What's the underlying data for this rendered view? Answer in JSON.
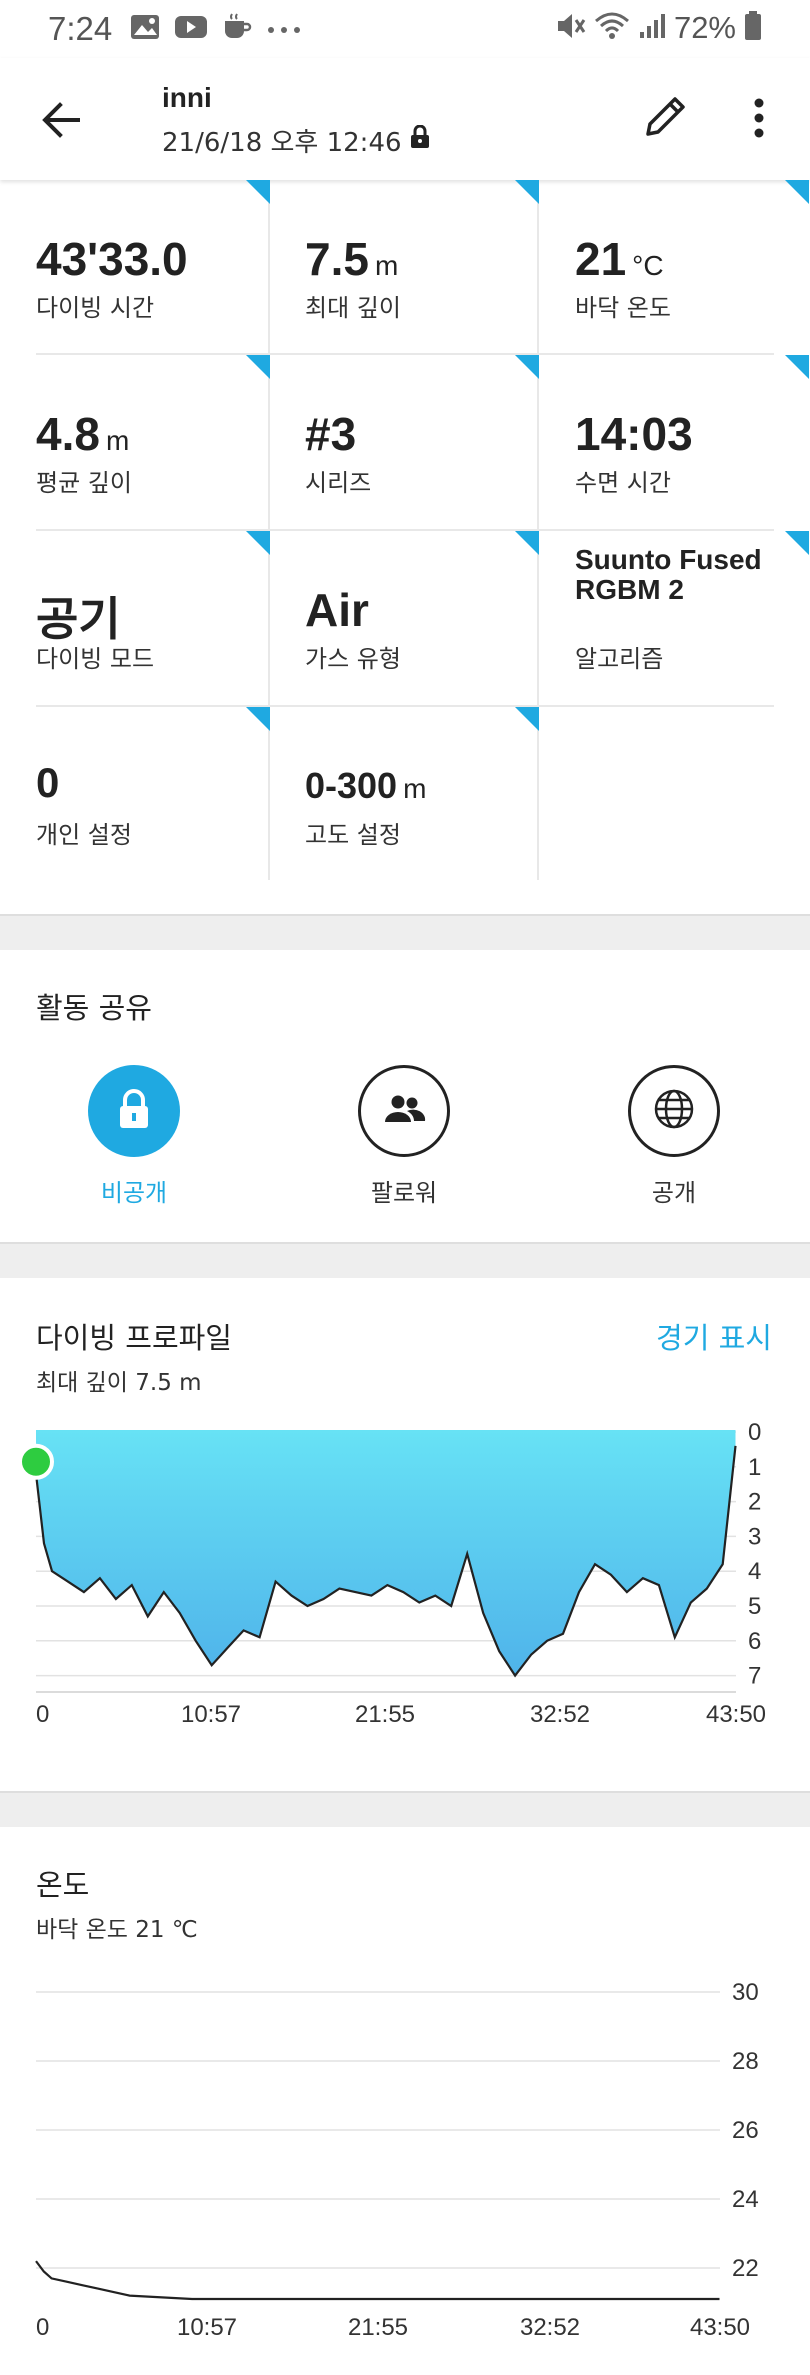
{
  "status_bar": {
    "time": "7:24",
    "battery": "72%"
  },
  "header": {
    "title": "inni",
    "subtitle": "21/6/18 오후 12:46",
    "icons": [
      "back-arrow-icon",
      "lock-icon",
      "edit-pencil-icon",
      "more-vert-icon"
    ]
  },
  "stats": [
    {
      "value": "43'33.0",
      "unit": "",
      "label": "다이빙 시간"
    },
    {
      "value": "7.5",
      "unit": "m",
      "label": "최대 깊이"
    },
    {
      "value": "21",
      "unit": "°C",
      "label": "바닥 온도"
    },
    {
      "value": "4.8",
      "unit": "m",
      "label": "평균 깊이"
    },
    {
      "value": "#3",
      "unit": "",
      "label": "시리즈"
    },
    {
      "value": "14:03",
      "unit": "",
      "label": "수면 시간"
    },
    {
      "value": "공기",
      "unit": "",
      "label": "다이빙 모드"
    },
    {
      "value": "Air",
      "unit": "",
      "label": "가스 유형"
    },
    {
      "value": "Suunto Fused RGBM 2",
      "unit": "",
      "label": "알고리즘"
    },
    {
      "value": "0",
      "unit": "",
      "label": "개인 설정"
    },
    {
      "value": "0-300",
      "unit": "m",
      "label": "고도 설정"
    }
  ],
  "share": {
    "title": "활동 공유",
    "options": [
      {
        "label": "비공개",
        "icon": "lock-icon",
        "selected": true
      },
      {
        "label": "팔로워",
        "icon": "people-icon",
        "selected": false
      },
      {
        "label": "공개",
        "icon": "globe-icon",
        "selected": false
      }
    ]
  },
  "dive_profile": {
    "title": "다이빙 프로파일",
    "subtitle": "최대 깊이 7.5 m",
    "link": "경기 표시"
  },
  "temperature": {
    "title": "온도",
    "subtitle": "바닥 온도 21 ℃"
  },
  "colors": {
    "accent": "#1fa9e1",
    "start_marker": "#2ecc40",
    "depth_fill_top": "#67e2f5",
    "depth_fill_bottom": "#4fb3ea"
  },
  "chart_data": [
    {
      "type": "area",
      "title": "다이빙 프로파일",
      "x_ticks": [
        "0",
        "10:57",
        "21:55",
        "32:52",
        "43:50"
      ],
      "y_ticks": [
        "0",
        "1",
        "2",
        "3",
        "4",
        "5",
        "6",
        "7"
      ],
      "ylim": [
        0,
        7.5
      ],
      "y_inverted": true,
      "grid": true,
      "series": [
        {
          "x_minutes": [
            0,
            0.5,
            1,
            2,
            3,
            4,
            5,
            6,
            7,
            8,
            9,
            10,
            11,
            12,
            13,
            14,
            15,
            16,
            17,
            18,
            19,
            20,
            21,
            22,
            23,
            24,
            25,
            26,
            27,
            28,
            29,
            30,
            31,
            32,
            33,
            34,
            35,
            36,
            37,
            38,
            39,
            40,
            41,
            42,
            43,
            43.8
          ],
          "values": [
            1.2,
            3.2,
            4.0,
            4.3,
            4.6,
            4.2,
            4.8,
            4.4,
            5.3,
            4.6,
            5.2,
            6.0,
            6.7,
            6.2,
            5.7,
            5.9,
            4.3,
            4.7,
            5.0,
            4.8,
            4.5,
            4.6,
            4.7,
            4.4,
            4.6,
            4.9,
            4.7,
            5.0,
            3.5,
            5.2,
            6.3,
            7.0,
            6.4,
            6.0,
            5.8,
            4.6,
            3.8,
            4.1,
            4.6,
            4.2,
            4.4,
            5.9,
            4.9,
            4.5,
            3.8,
            0.4
          ]
        }
      ]
    },
    {
      "type": "line",
      "title": "온도",
      "x_ticks": [
        "0",
        "10:57",
        "21:55",
        "32:52",
        "43:50"
      ],
      "y_ticks": [
        "22",
        "24",
        "26",
        "28",
        "30"
      ],
      "ylim": [
        21,
        30.5
      ],
      "grid": true,
      "series": [
        {
          "x_minutes": [
            0,
            0.5,
            1,
            2,
            3,
            4,
            6,
            10,
            15,
            20,
            25,
            30,
            35,
            40,
            43,
            43.8
          ],
          "values": [
            22.2,
            21.9,
            21.7,
            21.6,
            21.5,
            21.4,
            21.2,
            21.1,
            21.1,
            21.1,
            21.1,
            21.1,
            21.1,
            21.1,
            21.1,
            21.1
          ]
        }
      ]
    }
  ]
}
